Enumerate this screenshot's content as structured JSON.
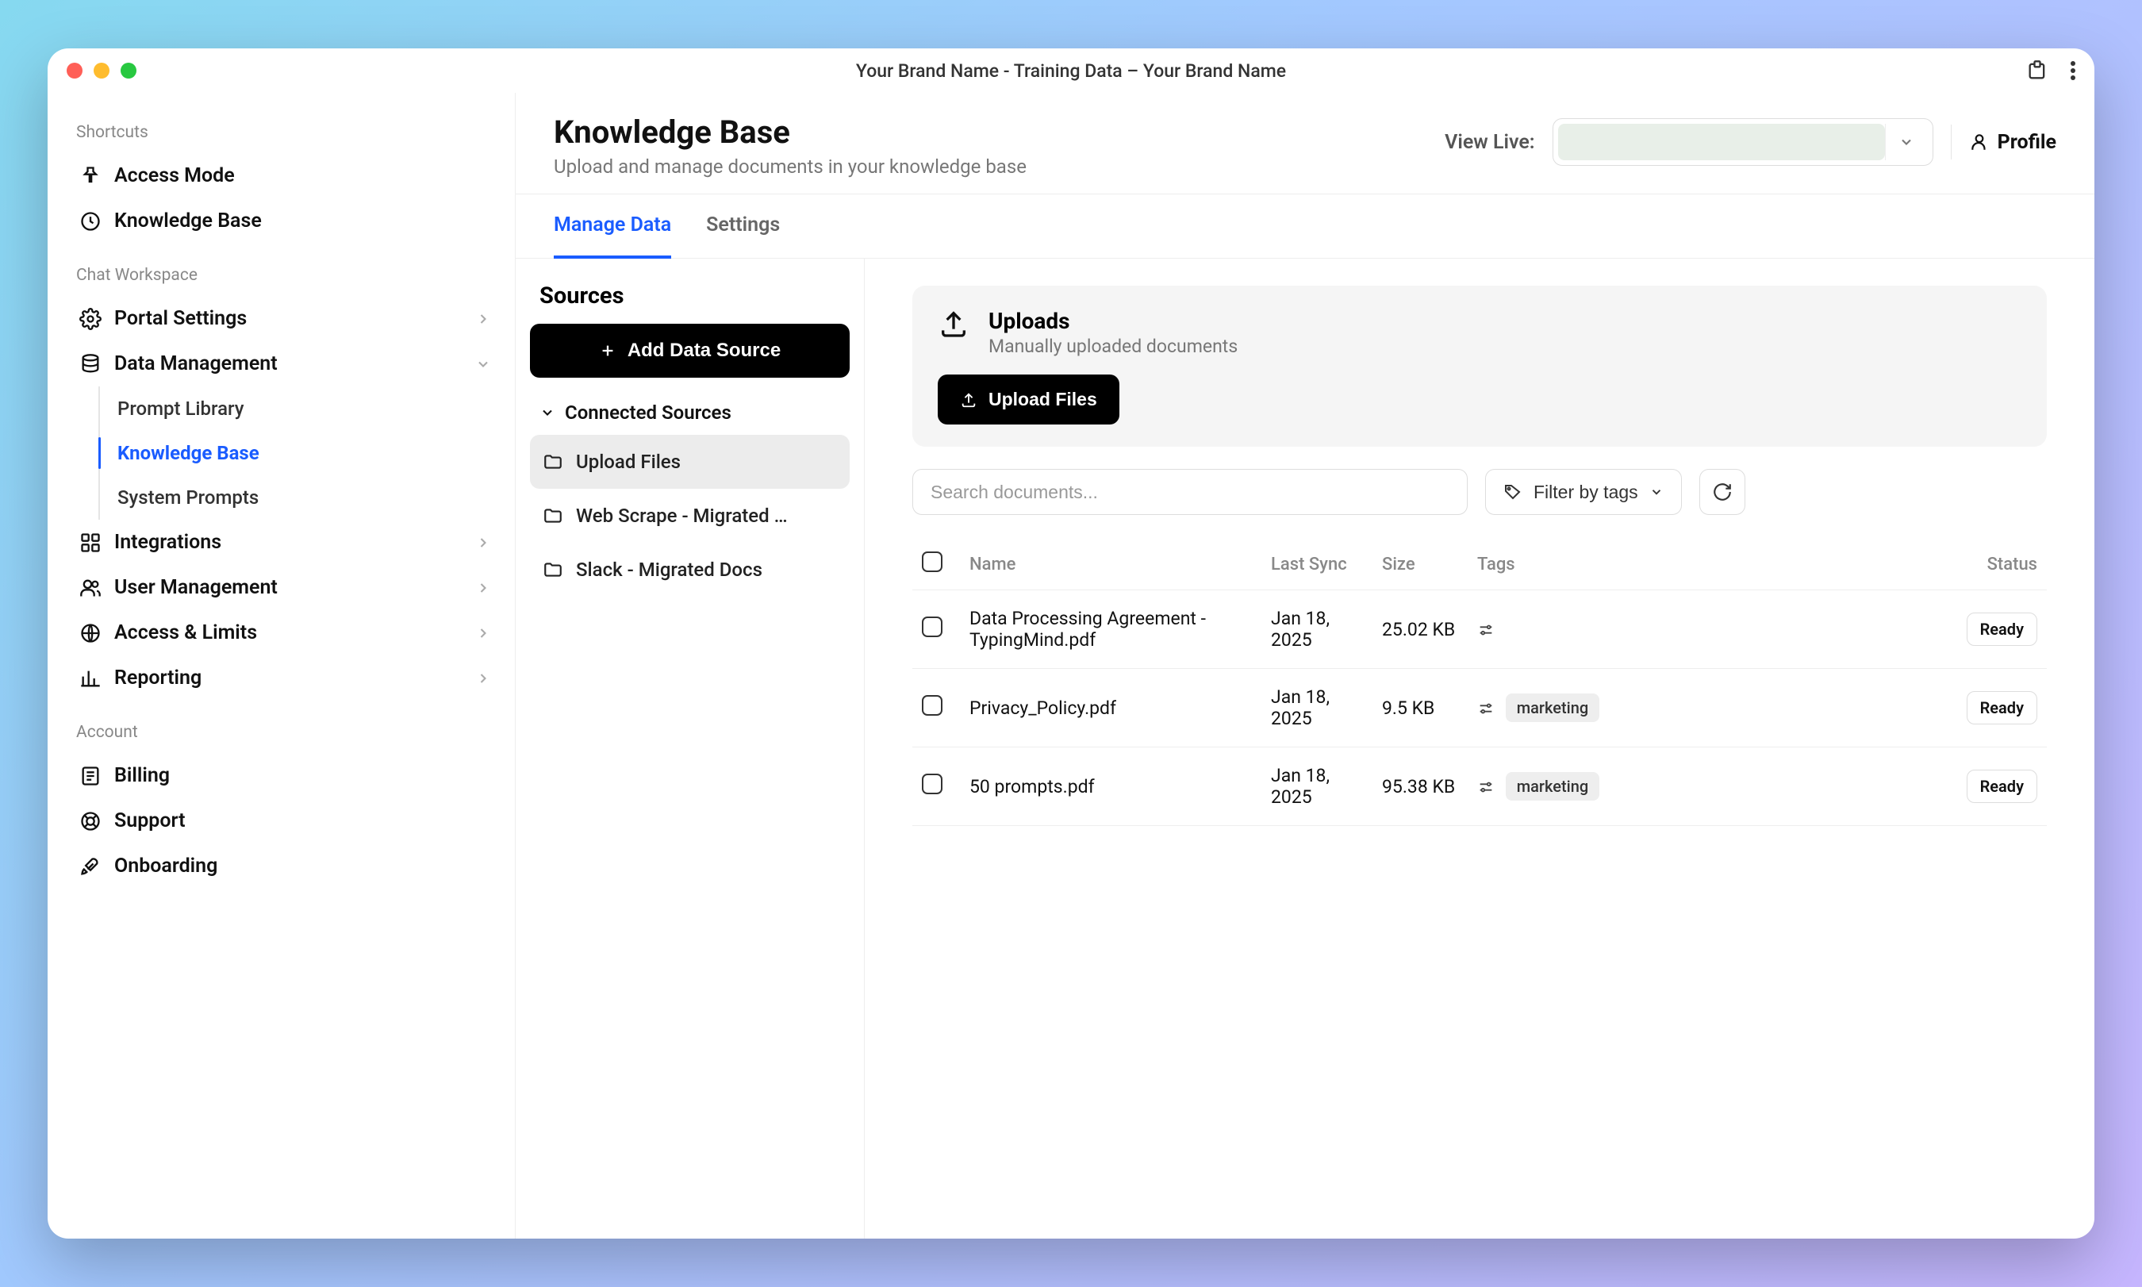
{
  "window": {
    "title": "Your Brand Name - Training Data – Your Brand Name"
  },
  "sidebar": {
    "sections": {
      "shortcuts_label": "Shortcuts",
      "workspace_label": "Chat Workspace",
      "account_label": "Account"
    },
    "shortcuts": [
      {
        "label": "Access Mode"
      },
      {
        "label": "Knowledge Base"
      }
    ],
    "workspace": [
      {
        "label": "Portal Settings"
      },
      {
        "label": "Data Management",
        "expanded": true,
        "children": [
          {
            "label": "Prompt Library"
          },
          {
            "label": "Knowledge Base",
            "active": true
          },
          {
            "label": "System Prompts"
          }
        ]
      },
      {
        "label": "Integrations"
      },
      {
        "label": "User Management"
      },
      {
        "label": "Access & Limits"
      },
      {
        "label": "Reporting"
      }
    ],
    "account": [
      {
        "label": "Billing"
      },
      {
        "label": "Support"
      },
      {
        "label": "Onboarding"
      }
    ]
  },
  "header": {
    "title": "Knowledge Base",
    "subtitle": "Upload and manage documents in your knowledge base",
    "view_live_label": "View Live:",
    "profile_label": "Profile"
  },
  "tabs": [
    {
      "label": "Manage Data",
      "active": true
    },
    {
      "label": "Settings"
    }
  ],
  "sources": {
    "title": "Sources",
    "add_button": "Add Data Source",
    "connected_header": "Connected Sources",
    "items": [
      {
        "label": "Upload Files",
        "active": true
      },
      {
        "label": "Web Scrape - Migrated …"
      },
      {
        "label": "Slack - Migrated Docs"
      }
    ]
  },
  "uploads": {
    "title": "Uploads",
    "subtitle": "Manually uploaded documents",
    "upload_button": "Upload Files"
  },
  "controls": {
    "search_placeholder": "Search documents...",
    "filter_label": "Filter by tags"
  },
  "table": {
    "columns": {
      "name": "Name",
      "last_sync": "Last Sync",
      "size": "Size",
      "tags": "Tags",
      "status": "Status"
    },
    "rows": [
      {
        "name": "Data Processing Agreement - TypingMind.pdf",
        "last_sync": "Jan 18, 2025",
        "size": "25.02 KB",
        "tags": [],
        "status": "Ready"
      },
      {
        "name": "Privacy_Policy.pdf",
        "last_sync": "Jan 18, 2025",
        "size": "9.5 KB",
        "tags": [
          "marketing"
        ],
        "status": "Ready"
      },
      {
        "name": "50 prompts.pdf",
        "last_sync": "Jan 18, 2025",
        "size": "95.38 KB",
        "tags": [
          "marketing"
        ],
        "status": "Ready"
      }
    ]
  }
}
